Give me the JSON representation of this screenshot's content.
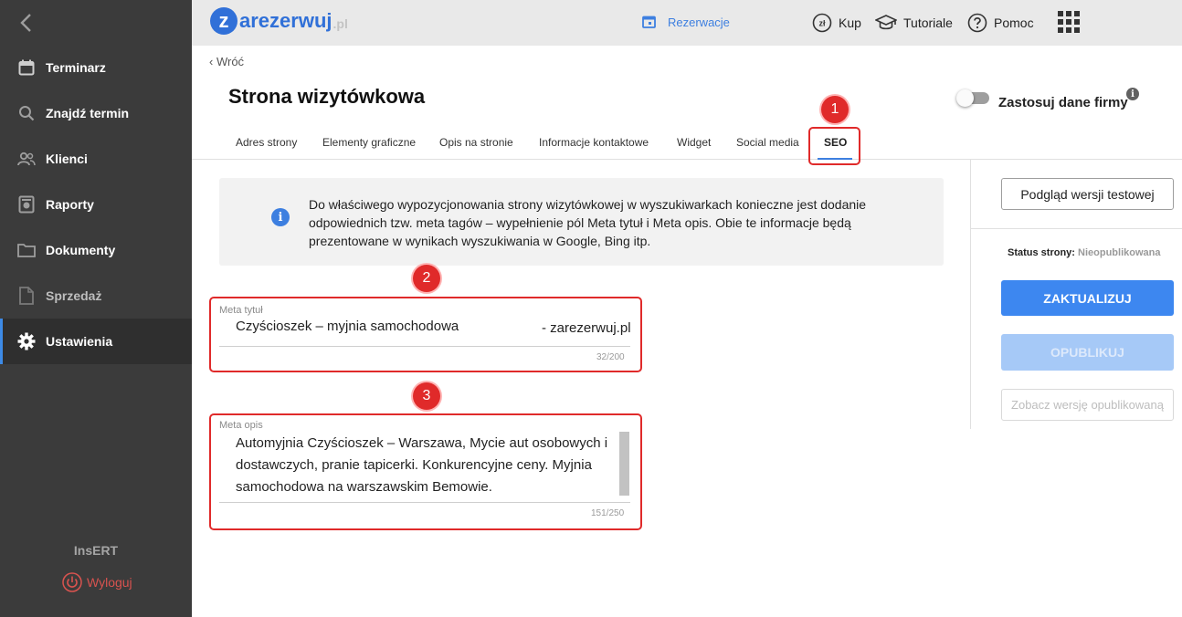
{
  "sidebar": {
    "items": [
      {
        "label": "Terminarz",
        "icon": "calendar-icon"
      },
      {
        "label": "Znajdź termin",
        "icon": "search-icon"
      },
      {
        "label": "Klienci",
        "icon": "users-icon"
      },
      {
        "label": "Raporty",
        "icon": "report-icon"
      },
      {
        "label": "Dokumenty",
        "icon": "folder-icon"
      },
      {
        "label": "Sprzedaż",
        "icon": "document-icon"
      },
      {
        "label": "Ustawienia",
        "icon": "gear-icon",
        "active": true
      }
    ],
    "brand": "InsERT",
    "logout_label": "Wyloguj"
  },
  "topbar": {
    "logo_letter": "z",
    "logo_text": "arezerwuj",
    "logo_suffix": ".pl",
    "reservations_label": "Rezerwacje",
    "buy_icon_text": "zł",
    "buy_label": "Kup",
    "tutorials_label": "Tutoriale",
    "help_label": "Pomoc"
  },
  "page": {
    "back_label": "Wróć",
    "title": "Strona wizytówkowa",
    "toggle_label": "Zastosuj dane firmy"
  },
  "tabs": [
    {
      "label": "Adres strony"
    },
    {
      "label": "Elementy graficzne"
    },
    {
      "label": "Opis na stronie"
    },
    {
      "label": "Informacje kontaktowe"
    },
    {
      "label": "Widget"
    },
    {
      "label": "Social media"
    },
    {
      "label": "SEO",
      "active": true
    }
  ],
  "annotations": {
    "badge1": "1",
    "badge2": "2",
    "badge3": "3"
  },
  "info": {
    "text": "Do właściwego wypozycjonowania strony wizytówkowej w wyszukiwarkach konieczne jest dodanie odpowiednich tzw. meta tagów – wypełnienie pól Meta tytuł i Meta opis. Obie te informacje będą prezentowane w wynikach wyszukiwania w Google, Bing itp."
  },
  "meta_title": {
    "label": "Meta tytuł",
    "value": "Czyścioszek – myjnia samochodowa",
    "suffix": "- zarezerwuj.pl",
    "counter": "32/200"
  },
  "meta_description": {
    "label": "Meta opis",
    "value": "Automyjnia Czyścioszek – Warszawa, Mycie aut osobowych i dostawczych, pranie tapicerki. Konkurencyjne ceny. Myjnia samochodowa na warszawskim Bemowie.",
    "counter": "151/250"
  },
  "right_panel": {
    "preview_label": "Podgląd wersji testowej",
    "status_label": "Status strony:",
    "status_value": "Nieopublikowana",
    "update_label": "ZAKTUALIZUJ",
    "publish_label": "OPUBLIKUJ",
    "view_published_label": "Zobacz wersję opublikowaną"
  },
  "colors": {
    "accent": "#3d87f0",
    "sidebar_bg": "#3b3b3b",
    "highlight": "#e02a2a"
  }
}
